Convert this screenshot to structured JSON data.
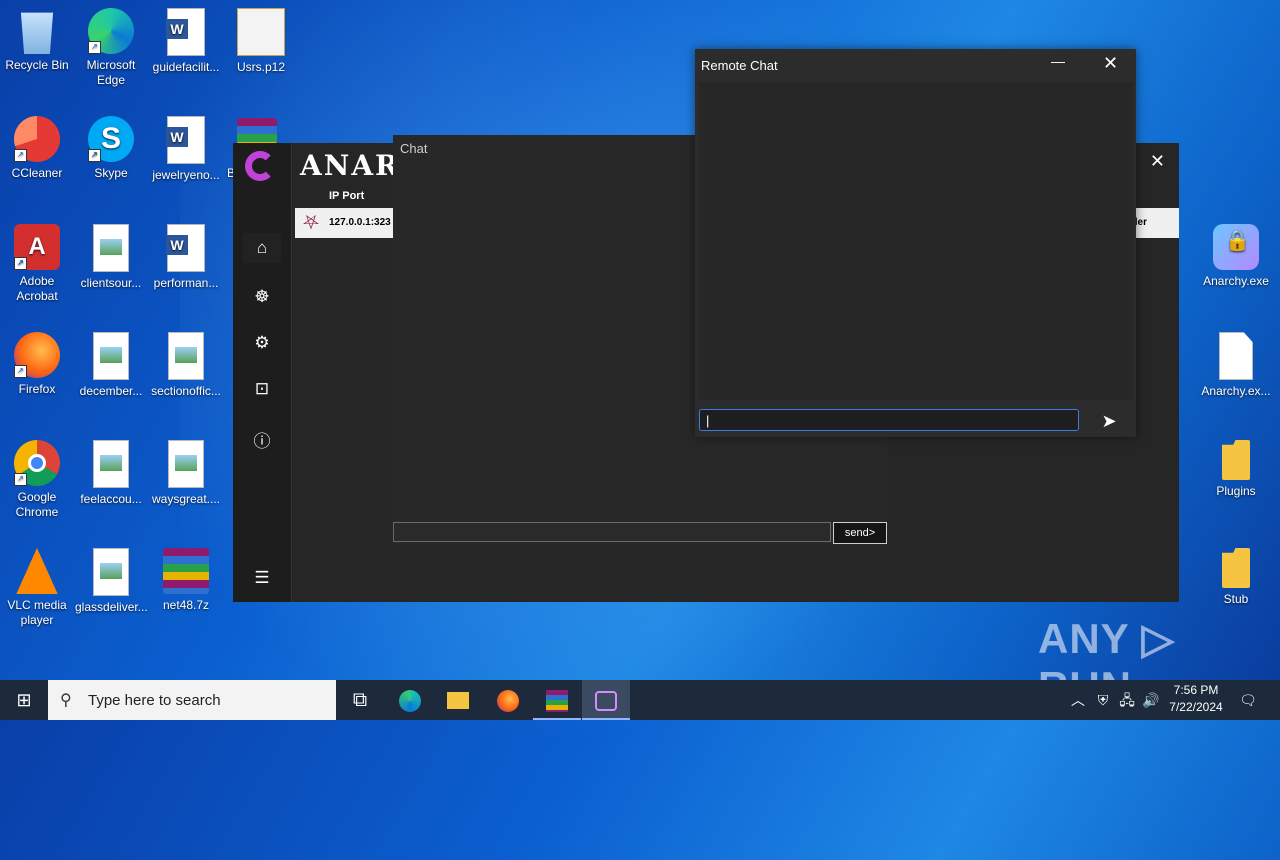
{
  "desktop": {
    "icons": [
      {
        "label": "Recycle Bin",
        "icon": "recycle-bin-icon"
      },
      {
        "label": "Microsoft Edge",
        "icon": "edge-icon"
      },
      {
        "label": "guidefacilit...",
        "icon": "word-document-icon"
      },
      {
        "label": "Usrs.p12",
        "icon": "certificate-icon"
      },
      {
        "label": "CCleaner",
        "icon": "ccleaner-icon"
      },
      {
        "label": "Skype",
        "icon": "skype-icon"
      },
      {
        "label": "jewelryeno...",
        "icon": "word-document-icon"
      },
      {
        "label": "B",
        "icon": "winrar-icon"
      },
      {
        "label": "Adobe Acrobat",
        "icon": "acrobat-icon"
      },
      {
        "label": "clientsour...",
        "icon": "image-file-icon"
      },
      {
        "label": "performan...",
        "icon": "word-document-icon"
      },
      {
        "label": "Firefox",
        "icon": "firefox-icon"
      },
      {
        "label": "december...",
        "icon": "image-file-icon"
      },
      {
        "label": "sectionoffic...",
        "icon": "image-file-icon"
      },
      {
        "label": "Google Chrome",
        "icon": "chrome-icon"
      },
      {
        "label": "feelaccou...",
        "icon": "image-file-icon"
      },
      {
        "label": "waysgreat....",
        "icon": "image-file-icon"
      },
      {
        "label": "VLC media player",
        "icon": "vlc-icon"
      },
      {
        "label": "glassdeliver...",
        "icon": "image-file-icon"
      },
      {
        "label": "net48.7z",
        "icon": "winrar-icon"
      },
      {
        "label": "Anarchy.exe",
        "icon": "anarchy-lock-icon"
      },
      {
        "label": "Anarchy.ex...",
        "icon": "blank-file-icon"
      },
      {
        "label": "Plugins",
        "icon": "folder-icon"
      },
      {
        "label": "Stub",
        "icon": "folder-icon"
      }
    ]
  },
  "main_window": {
    "title": "ANAR",
    "close": "✕",
    "column_header": "IP Port",
    "row": {
      "ip": "127.0.0.1:323",
      "tail": "ler"
    },
    "sidebar": [
      "home-icon",
      "users-icon",
      "settings-icon",
      "builder-icon",
      "info-icon",
      "menu-list-icon"
    ]
  },
  "chat_window": {
    "title": "Chat",
    "send_label": "send>",
    "input_value": ""
  },
  "remote_chat": {
    "title": "Remote Chat",
    "minimize": "—",
    "close": "✕",
    "input_value": "|",
    "send_icon": "send-arrow-icon"
  },
  "watermark": "ANY ▷ RUN",
  "taskbar": {
    "search_placeholder": "Type here to search",
    "time": "7:56 PM",
    "date": "7/22/2024"
  }
}
